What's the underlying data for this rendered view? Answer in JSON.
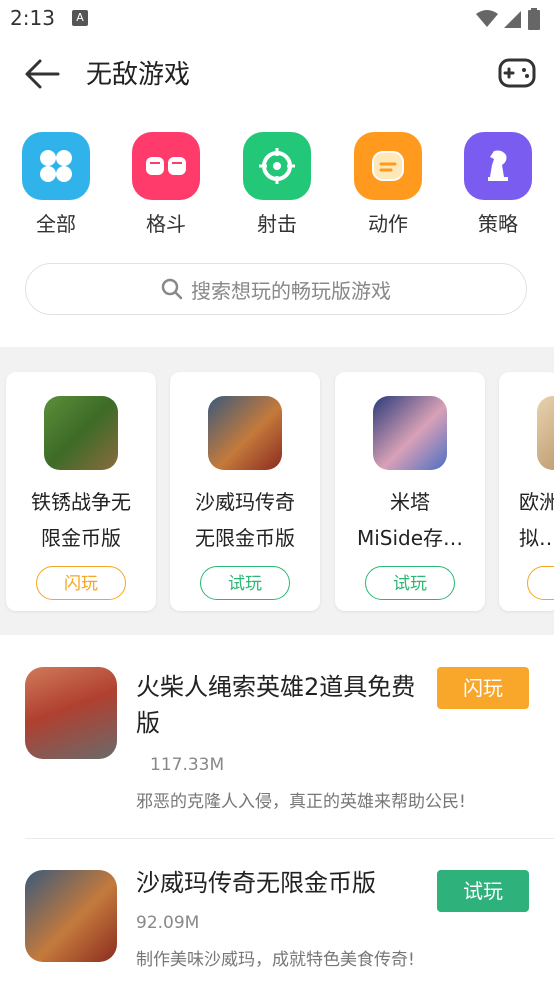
{
  "status": {
    "time": "2:13"
  },
  "appbar": {
    "title": "无敌游戏"
  },
  "categories": [
    {
      "label": "全部",
      "color": "#2fb3ea",
      "icon": "four-petal-icon"
    },
    {
      "label": "格斗",
      "color": "#ff3b6b",
      "icon": "fists-icon"
    },
    {
      "label": "射击",
      "color": "#22c777",
      "icon": "crosshair-icon"
    },
    {
      "label": "动作",
      "color": "#ff9a1e",
      "icon": "punch-icon"
    },
    {
      "label": "策略",
      "color": "#7b5cf0",
      "icon": "chess-knight-icon"
    }
  ],
  "search": {
    "placeholder": "搜索想玩的畅玩版游戏"
  },
  "cards": [
    {
      "name": "铁锈战争无\n限金币版",
      "action": "闪玩",
      "style": "orange"
    },
    {
      "name": "沙威玛传奇\n无限金币版",
      "action": "试玩",
      "style": "green"
    },
    {
      "name": "米塔\nMiSide存…",
      "action": "试玩",
      "style": "green"
    },
    {
      "name": "欧洲\n拟…",
      "action": "",
      "style": "orange"
    }
  ],
  "list": [
    {
      "name": "火柴人绳索英雄2道具免费版",
      "size": "117.33M",
      "desc": "邪恶的克隆人入侵，真正的英雄来帮助公民!",
      "action": "闪玩",
      "style": "orange"
    },
    {
      "name": "沙威玛传奇无限金币版",
      "size": "92.09M",
      "desc": "制作美味沙威玛，成就特色美食传奇!",
      "action": "试玩",
      "style": "green"
    }
  ]
}
